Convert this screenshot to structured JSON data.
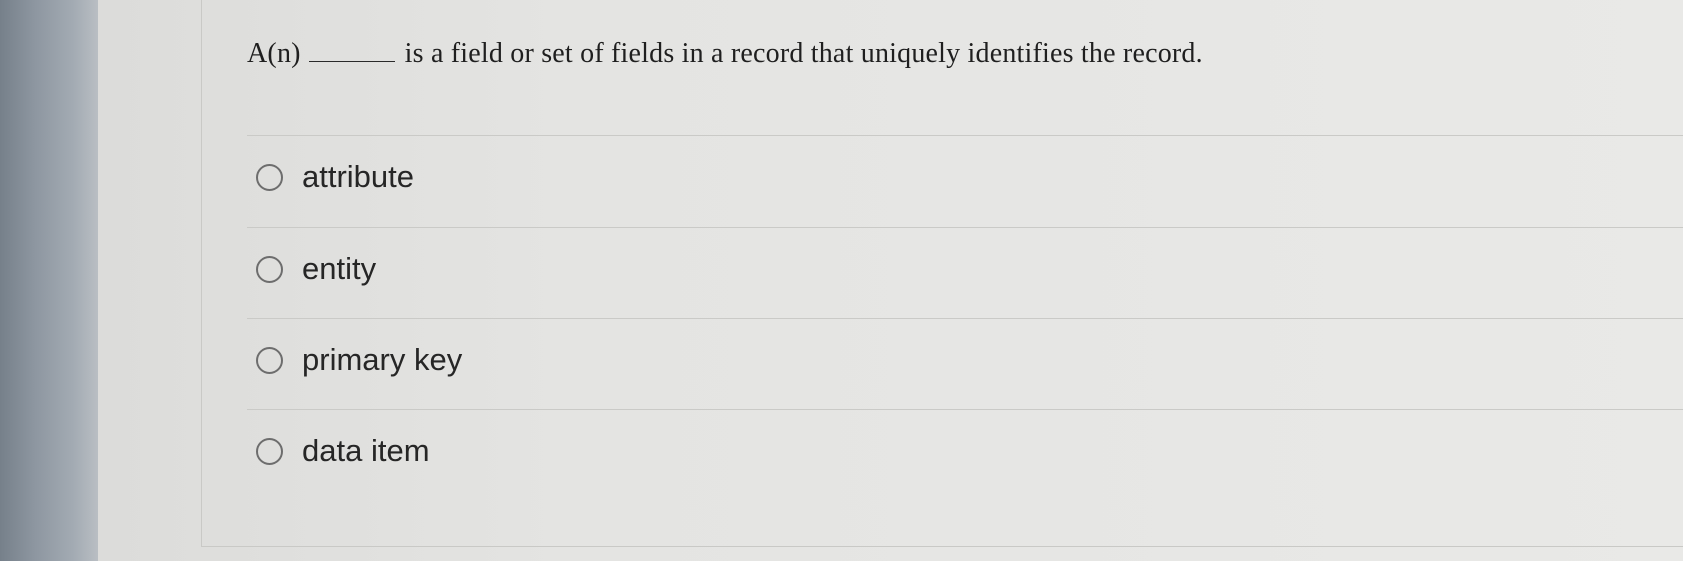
{
  "question": {
    "prefix": "A(n)",
    "suffix": "is a field or set of fields in a record that uniquely identifies the record."
  },
  "options": [
    {
      "label": "attribute",
      "selected": false
    },
    {
      "label": "entity",
      "selected": false
    },
    {
      "label": "primary key",
      "selected": false
    },
    {
      "label": "data item",
      "selected": false
    }
  ]
}
